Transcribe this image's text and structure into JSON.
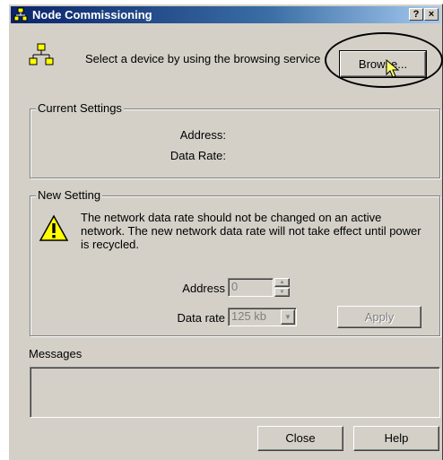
{
  "window": {
    "title": "Node Commissioning",
    "help_button": "?",
    "close_button": "×"
  },
  "header": {
    "instruction": "Select a device by using the browsing service",
    "browse_label": "Browse..."
  },
  "current_settings": {
    "label": "Current Settings",
    "address_label": "Address:",
    "data_rate_label": "Data Rate:"
  },
  "new_setting": {
    "label": "New Setting",
    "warning_line1": "The network data rate should not be changed on an active",
    "warning_line2": "network. The new network data rate will not take effect until power",
    "warning_line3": "is recycled.",
    "address_label": "Address",
    "address_value": "0",
    "data_rate_label": "Data rate",
    "data_rate_value": "125 kb",
    "apply_label": "Apply"
  },
  "messages": {
    "label": "Messages"
  },
  "footer": {
    "close_label": "Close",
    "help_label": "Help"
  },
  "icons": {
    "title": "network-node-icon",
    "header": "network-tree-icon",
    "warning": "warning-icon",
    "cursor": "mouse-pointer-icon"
  },
  "colors": {
    "dialog_face": "#d4d0c8",
    "title_start": "#0a246a",
    "title_end": "#a6caf0",
    "warning_yellow": "#ffff00",
    "disabled_text": "#808080"
  }
}
